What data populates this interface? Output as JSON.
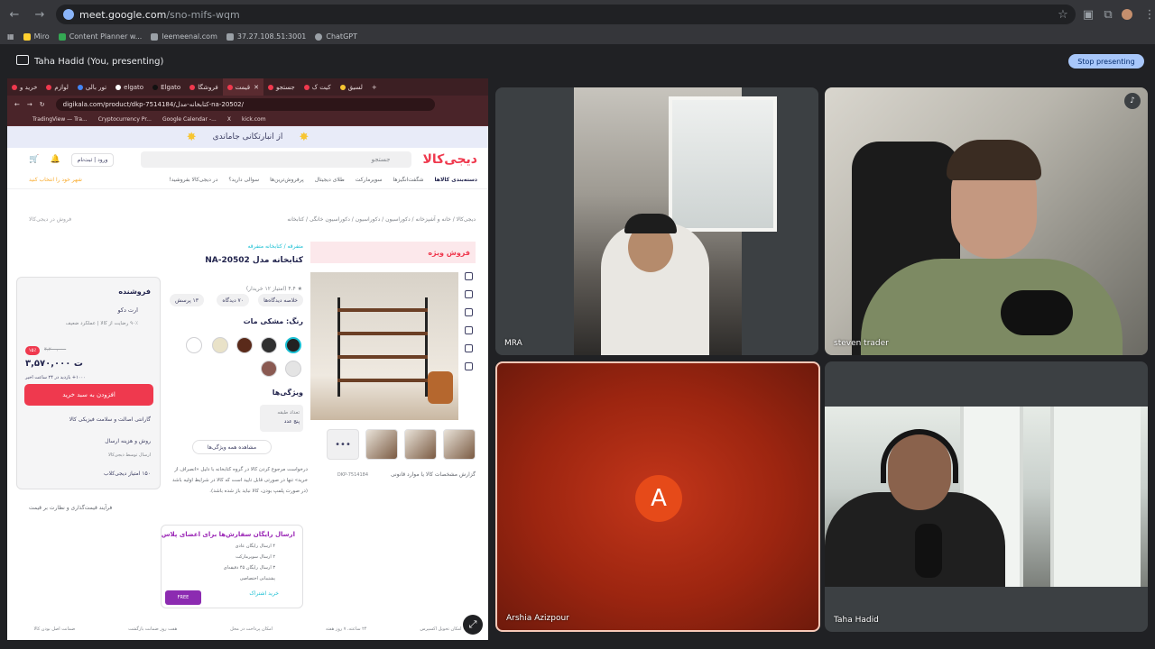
{
  "browser": {
    "url_host": "meet.google.com",
    "url_path": "/sno-mifs-wqm",
    "bookmarks": [
      {
        "label": "Miro",
        "color": "#ffd02f"
      },
      {
        "label": "Content Planner w...",
        "color": "#34a853"
      },
      {
        "label": "leemeenal.com",
        "color": "#9aa0a6"
      },
      {
        "label": "37.27.108.51:3001",
        "color": "#9aa0a6"
      },
      {
        "label": "ChatGPT",
        "color": "#9aa0a6"
      }
    ]
  },
  "meet": {
    "presenting_label": "Taha Hadid (You, presenting)",
    "stop_label": "Stop presenting",
    "participants": {
      "p1": "MRA",
      "p2": "steven trader",
      "p3": "Arshia Azizpour",
      "p3_initial": "A",
      "p4": "Taha Hadid"
    }
  },
  "shared": {
    "tabs": [
      "خرید و",
      "لوازم",
      "تور بالی",
      "elgato",
      "Elgato",
      "فروشگا",
      "قیمت",
      "جستجو",
      "کیت ک",
      "لسیق"
    ],
    "url": "digikala.com/product/dkp-7514184/کتابخانه-مدل-na-20502/",
    "bookmarks": [
      "TradingView — Tra...",
      "Cryptocurrency Pr...",
      "Google Calendar -...",
      "X",
      "kick.com"
    ],
    "banner": "از انبارتکانی جاماندی",
    "logo": "دیجی‌کالا",
    "search_placeholder": "جستجو",
    "login": "ورود | ثبت‌نام",
    "nav": [
      "دسته‌بندی کالاها",
      "شگفت‌انگیزها",
      "سوپرمارکت",
      "طلای دیجیتال",
      "پرفروش‌ترین‌ها",
      "سوالی دارید؟",
      "در دیجی‌کالا بفروشید!"
    ],
    "city": "شهر خود را انتخاب کنید",
    "breadcrumb": "دیجی‌کالا / خانه و آشپزخانه / دکوراسیون / دکوراسیون / دکوراسیون خانگی / کتابخانه",
    "sell_here": "فروش در دیجی‌کالا",
    "special": "فروش ویژه",
    "category": "متفرقه / کتابخانه متفرقه",
    "title": "کتابخانه مدل NA-20502",
    "stats": "★ ۴.۴ (امتیاز ۱۲ خریدار)",
    "chips": [
      "خلاصه دیدگاه‌ها",
      "۷۰ دیدگاه",
      "۱۳ پرسش"
    ],
    "color_label": "رنگ: مشکی مات",
    "swatches": [
      "#222222",
      "#303030",
      "#5a2a1a",
      "#e9e2c8",
      "#ffffff",
      "#e4e4e4",
      "#8a5a52"
    ],
    "features_label": "ویژگی‌ها",
    "feature_key": "تعداد طبقه",
    "feature_val": "پنج عدد",
    "see_all": "مشاهده همه ویژگی‌ها",
    "disclaimer": "درخواست مرجوع کردن کالا در گروه کتابخانه با دلیل «انصراف از خرید» تنها در صورتی قابل تایید است که کالا در شرایط اولیه باشد (در صورت پلمپ بودن، کالا نباید باز شده باشد).",
    "report": "گزارش مشخصات کالا یا موارد قانونی",
    "dkp": "DKP-7514184",
    "thumb_more": "•••",
    "seller_heading": "فروشنده",
    "seller_name": "ارت دکو",
    "seller_meta": "۹۰٪ رضایت از کالا  |  عملکرد ضعیف",
    "discount": "۱۵٪",
    "old_price": "۴,۲۰۰,۰۰۰",
    "price": "۳,۵۷۰,۰۰۰ ت",
    "sold": "۱۰۰۰+ بازدید در ۲۴ ساعت اخیر",
    "add_to_cart": "افزودن به سبد خرید",
    "guarantee": "گارانتی اصالت و سلامت فیزیکی کالا",
    "shipping": "روش و هزینه ارسال",
    "shipping_sub": "ارسال توسط دیجی‌کالا",
    "points": "۱۵۰ امتیاز دیجی‌کلاب",
    "price_note": "فرآیند قیمت‌گذاری و نظارت بر قیمت",
    "plus_title": "ارسال رایگان سفارش‌ها برای اعضای پلاس",
    "plus_items": [
      "۴ ارسال رایگان عادی",
      "۲ ارسال سوپرمارکت",
      "۳ ارسال رایگان ۴۵ دقیقه‌ای",
      "پشتیبانی اختصاصی"
    ],
    "plus_buy": "خرید اشتراک",
    "free": "FREE",
    "footer": [
      "امکان تحویل اکسپرس",
      "۲۴ ساعته، ۷ روز هفته",
      "امکان پرداخت در محل",
      "هفت روز ضمانت بازگشت",
      "ضمانت اصل بودن کالا"
    ]
  }
}
